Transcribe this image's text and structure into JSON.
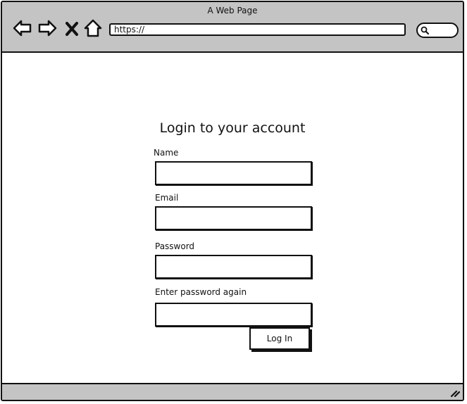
{
  "window": {
    "title": "A Web Page"
  },
  "toolbar": {
    "back_icon": "back-arrow-icon",
    "forward_icon": "forward-arrow-icon",
    "stop_icon": "close-icon",
    "home_icon": "home-icon",
    "url": "https://",
    "search_icon": "search-icon"
  },
  "form": {
    "title": "Login to your account",
    "fields": [
      {
        "label": "Name",
        "value": ""
      },
      {
        "label": "Email",
        "value": ""
      },
      {
        "label": "Password",
        "value": ""
      },
      {
        "label": "Enter password again",
        "value": ""
      }
    ],
    "submit_label": "Log In"
  },
  "statusbar": {
    "grip_icon": "resize-grip-icon"
  },
  "colors": {
    "chrome": "#c4c4c4",
    "ink": "#111111",
    "background": "#ffffff"
  }
}
